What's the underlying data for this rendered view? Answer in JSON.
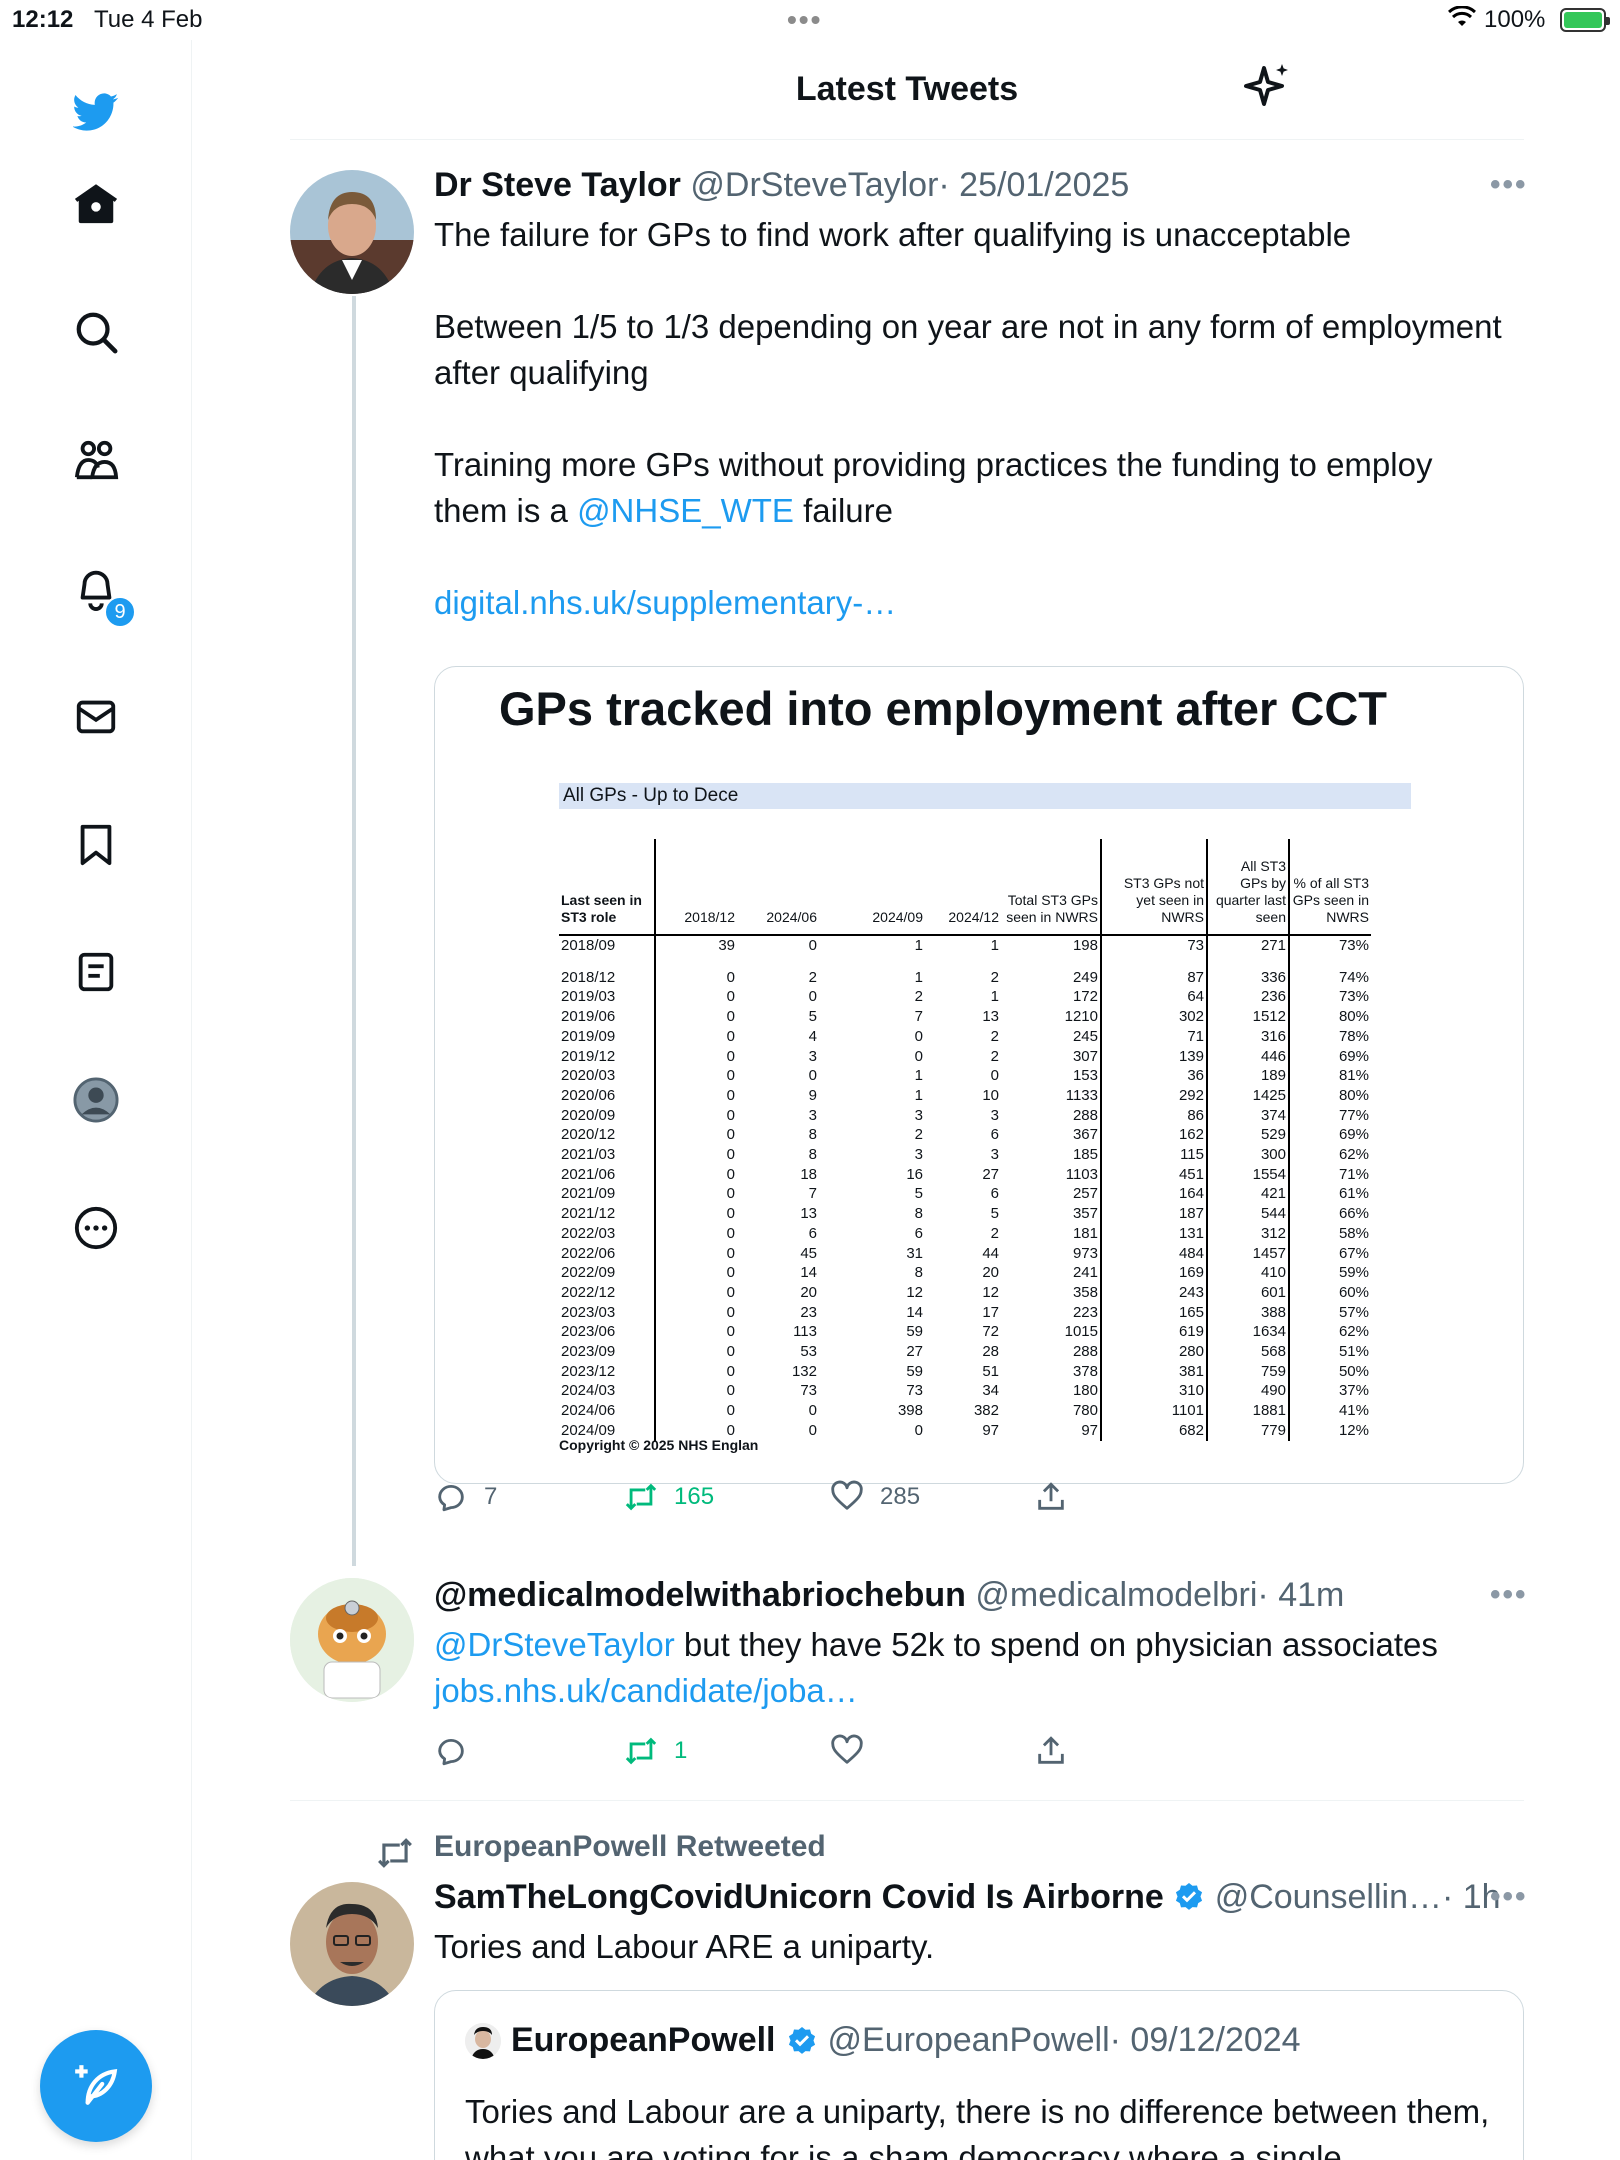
{
  "status_bar": {
    "time": "12:12",
    "date": "Tue 4 Feb",
    "battery": "100%"
  },
  "sidebar": {
    "notification_count": "9",
    "icons": [
      "twitter-logo-icon",
      "home-icon",
      "search-icon",
      "communities-icon",
      "notifications-icon",
      "messages-icon",
      "bookmarks-icon",
      "lists-icon",
      "profile-icon",
      "more-icon",
      "compose-icon"
    ]
  },
  "header": {
    "title": "Latest Tweets"
  },
  "tweet1": {
    "name": "Dr Steve Taylor",
    "handle": "@DrSteveTaylor",
    "date": "· 25/01/2025",
    "line1": "The failure for GPs to find work after qualifying is unacceptable",
    "line2": "Between 1/5 to 1/3 depending on year are not in any form of employment after qualifying",
    "line3_pre": "Training more GPs without providing practices the funding to employ them is a ",
    "line3_mention": "@NHSE_WTE",
    "line3_post": " failure",
    "link": "digital.nhs.uk/supplementary-…",
    "replies": "7",
    "retweets": "165",
    "likes": "285",
    "image": {
      "title": "GPs tracked into employment after CCT",
      "banner": "All GPs - Up to Dece",
      "headers": [
        "Last seen in ST3 role",
        "2018/12",
        "2024/06",
        "2024/09",
        "2024/12",
        "Total ST3 GPs seen in NWRS",
        "ST3 GPs not yet seen in NWRS",
        "All ST3 GPs by quarter last seen",
        "% of all ST3 GPs seen in NWRS"
      ],
      "rows": [
        [
          "2018/09",
          "39",
          "0",
          "1",
          "1",
          "198",
          "73",
          "271",
          "73%"
        ],
        [
          "2018/12",
          "0",
          "2",
          "1",
          "2",
          "249",
          "87",
          "336",
          "74%"
        ],
        [
          "2019/03",
          "0",
          "0",
          "2",
          "1",
          "172",
          "64",
          "236",
          "73%"
        ],
        [
          "2019/06",
          "0",
          "5",
          "7",
          "13",
          "1210",
          "302",
          "1512",
          "80%"
        ],
        [
          "2019/09",
          "0",
          "4",
          "0",
          "2",
          "245",
          "71",
          "316",
          "78%"
        ],
        [
          "2019/12",
          "0",
          "3",
          "0",
          "2",
          "307",
          "139",
          "446",
          "69%"
        ],
        [
          "2020/03",
          "0",
          "0",
          "1",
          "0",
          "153",
          "36",
          "189",
          "81%"
        ],
        [
          "2020/06",
          "0",
          "9",
          "1",
          "10",
          "1133",
          "292",
          "1425",
          "80%"
        ],
        [
          "2020/09",
          "0",
          "3",
          "3",
          "3",
          "288",
          "86",
          "374",
          "77%"
        ],
        [
          "2020/12",
          "0",
          "8",
          "2",
          "6",
          "367",
          "162",
          "529",
          "69%"
        ],
        [
          "2021/03",
          "0",
          "8",
          "3",
          "3",
          "185",
          "115",
          "300",
          "62%"
        ],
        [
          "2021/06",
          "0",
          "18",
          "16",
          "27",
          "1103",
          "451",
          "1554",
          "71%"
        ],
        [
          "2021/09",
          "0",
          "7",
          "5",
          "6",
          "257",
          "164",
          "421",
          "61%"
        ],
        [
          "2021/12",
          "0",
          "13",
          "8",
          "5",
          "357",
          "187",
          "544",
          "66%"
        ],
        [
          "2022/03",
          "0",
          "6",
          "6",
          "2",
          "181",
          "131",
          "312",
          "58%"
        ],
        [
          "2022/06",
          "0",
          "45",
          "31",
          "44",
          "973",
          "484",
          "1457",
          "67%"
        ],
        [
          "2022/09",
          "0",
          "14",
          "8",
          "20",
          "241",
          "169",
          "410",
          "59%"
        ],
        [
          "2022/12",
          "0",
          "20",
          "12",
          "12",
          "358",
          "243",
          "601",
          "60%"
        ],
        [
          "2023/03",
          "0",
          "23",
          "14",
          "17",
          "223",
          "165",
          "388",
          "57%"
        ],
        [
          "2023/06",
          "0",
          "113",
          "59",
          "72",
          "1015",
          "619",
          "1634",
          "62%"
        ],
        [
          "2023/09",
          "0",
          "53",
          "27",
          "28",
          "288",
          "280",
          "568",
          "51%"
        ],
        [
          "2023/12",
          "0",
          "132",
          "59",
          "51",
          "378",
          "381",
          "759",
          "50%"
        ],
        [
          "2024/03",
          "0",
          "73",
          "73",
          "34",
          "180",
          "310",
          "490",
          "37%"
        ],
        [
          "2024/06",
          "0",
          "0",
          "398",
          "382",
          "780",
          "1101",
          "1881",
          "41%"
        ],
        [
          "2024/09",
          "0",
          "0",
          "0",
          "97",
          "97",
          "682",
          "779",
          "12%"
        ]
      ],
      "copyright": "Copyright © 2025 NHS Englan"
    }
  },
  "tweet2": {
    "name": "@medicalmodelwithabriochebun",
    "handle": "@medicalmodelbri",
    "time": "· 41m",
    "mention": "@DrSteveTaylor",
    "text": " but they have 52k to spend on physician associates",
    "link": "jobs.nhs.uk/candidate/joba…",
    "retweets": "1"
  },
  "tweet3": {
    "retweeted_by": "EuropeanPowell Retweeted",
    "name": "SamTheLongCovidUnicorn Covid Is Airborne",
    "handle": "@Counsellin…",
    "time": "· 1h",
    "text": "Tories and Labour ARE a uniparty.",
    "quote": {
      "name": "EuropeanPowell",
      "handle": "@EuropeanPowell",
      "date": "· 09/12/2024",
      "text": "Tories and Labour are a uniparty, there is no difference between them, what you are voting for is a sham democracy where a single"
    }
  }
}
